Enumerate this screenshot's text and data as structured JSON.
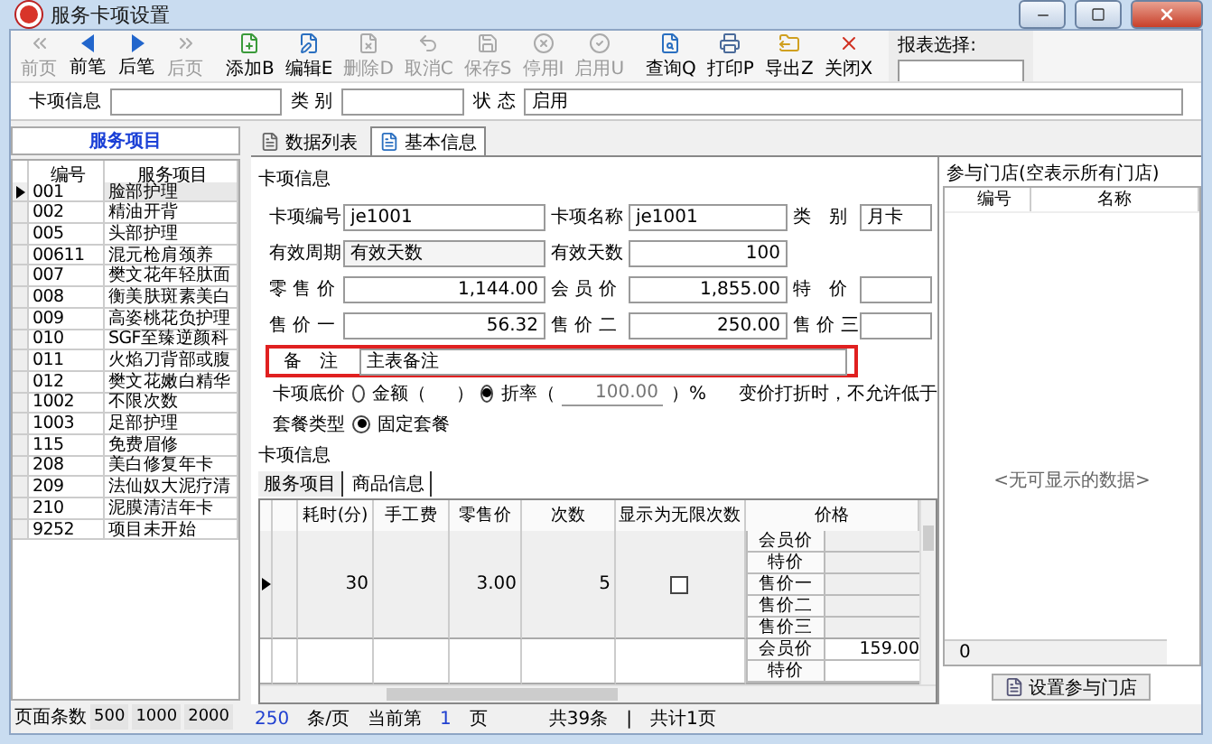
{
  "window": {
    "title": "服务卡项设置"
  },
  "toolbar": [
    {
      "kind": "first",
      "label": "前页",
      "disabled": true
    },
    {
      "kind": "prev",
      "label": "前笔",
      "disabled": false
    },
    {
      "kind": "next",
      "label": "后笔",
      "disabled": false
    },
    {
      "kind": "last",
      "label": "后页",
      "disabled": true
    },
    {
      "kind": "add",
      "label": "添加B",
      "disabled": false
    },
    {
      "kind": "edit",
      "label": "编辑E",
      "disabled": false
    },
    {
      "kind": "delete",
      "label": "删除D",
      "disabled": true
    },
    {
      "kind": "cancel",
      "label": "取消C",
      "disabled": true
    },
    {
      "kind": "save",
      "label": "保存S",
      "disabled": true
    },
    {
      "kind": "stop",
      "label": "停用I",
      "disabled": true
    },
    {
      "kind": "enable",
      "label": "启用U",
      "disabled": true
    },
    {
      "kind": "query",
      "label": "查询Q",
      "disabled": false
    },
    {
      "kind": "print",
      "label": "打印P",
      "disabled": false
    },
    {
      "kind": "export",
      "label": "导出Z",
      "disabled": false
    },
    {
      "kind": "close",
      "label": "关闭X",
      "disabled": false
    }
  ],
  "report_select": {
    "label": "报表选择:"
  },
  "filter": [
    {
      "label": "卡项信息"
    },
    {
      "label": "类 别"
    },
    {
      "label": "状 态",
      "value": "启用"
    }
  ],
  "left_panel": {
    "title": "服务项目",
    "columns": [
      "编号",
      "服务项目"
    ],
    "rows": [
      {
        "code": "001",
        "name": "脸部护理",
        "selected": true
      },
      {
        "code": "002",
        "name": "精油开背",
        "selected": false
      },
      {
        "code": "005",
        "name": "头部护理",
        "selected": false
      },
      {
        "code": "00611",
        "name": "混元枪肩颈养",
        "selected": false
      },
      {
        "code": "007",
        "name": "樊文花年轻肽面",
        "selected": false
      },
      {
        "code": "008",
        "name": "衡美肤斑素美白",
        "selected": false
      },
      {
        "code": "009",
        "name": "高姿桃花负护理",
        "selected": false
      },
      {
        "code": "010",
        "name": "SGF至臻逆颜科",
        "selected": false
      },
      {
        "code": "011",
        "name": "火焰刀背部或腹",
        "selected": false
      },
      {
        "code": "012",
        "name": "樊文花嫩白精华",
        "selected": false
      },
      {
        "code": "1002",
        "name": "不限次数",
        "selected": false
      },
      {
        "code": "1003",
        "name": "足部护理",
        "selected": false
      },
      {
        "code": "115",
        "name": "免费眉修",
        "selected": false
      },
      {
        "code": "208",
        "name": "美白修复年卡",
        "selected": false
      },
      {
        "code": "209",
        "name": "法仙奴大泥疗清",
        "selected": false
      },
      {
        "code": "210",
        "name": "泥膜清洁年卡",
        "selected": false
      },
      {
        "code": "9252",
        "name": "项目未开始",
        "selected": false
      }
    ],
    "page_sizes_label": "页面条数",
    "page_sizes": [
      "500",
      "1000",
      "2000"
    ]
  },
  "tabs": [
    {
      "label": "数据列表",
      "selected": false
    },
    {
      "label": "基本信息",
      "selected": true
    }
  ],
  "form": {
    "section": "卡项信息",
    "rows": [
      [
        {
          "label": "卡项编号",
          "value": "je1001"
        },
        {
          "label": "卡项名称",
          "value": "je1001"
        },
        {
          "label": "类　别",
          "value": "月卡"
        }
      ],
      [
        {
          "label": "有效周期",
          "value": "有效天数"
        },
        {
          "label": "有效天数",
          "value": "100"
        }
      ],
      [
        {
          "label": "零 售 价",
          "value": "1,144.00"
        },
        {
          "label": "会 员 价",
          "value": "1,855.00"
        },
        {
          "label": "特　价"
        }
      ],
      [
        {
          "label": "售 价 一",
          "value": "56.32"
        },
        {
          "label": "售 价 二",
          "value": "250.00"
        },
        {
          "label": "售 价 三"
        }
      ]
    ],
    "remark": {
      "label": "备　注",
      "value": "主表备注"
    },
    "floor": {
      "label": "卡项底价",
      "options": [
        {
          "label": "金额（",
          "close": "）",
          "selected": false
        },
        {
          "label": "折率（",
          "close": "）%",
          "placeholder": "100.00",
          "selected": true
        }
      ],
      "note": "变价打折时，不允许低于"
    },
    "package": {
      "label": "套餐类型",
      "options": [
        {
          "label": "固定套餐",
          "selected": true
        }
      ]
    },
    "section2": "卡项信息",
    "subtabs": [
      "服务项目",
      "商品信息"
    ]
  },
  "grid": {
    "columns": [
      "耗时(分)",
      "手工费",
      "零售价",
      "次数",
      "显示为无限次数",
      "价格"
    ],
    "rows": [
      {
        "selected": true,
        "time": "30",
        "retail": "3.00",
        "count": "5",
        "unlimited": false,
        "prices": [
          {
            "name": "会员价"
          },
          {
            "name": "特价"
          },
          {
            "name": "售价一"
          },
          {
            "name": "售价二"
          },
          {
            "name": "售价三"
          }
        ]
      },
      {
        "selected": false,
        "prices": [
          {
            "name": "会员价",
            "value": "159.00"
          },
          {
            "name": "特价"
          }
        ]
      }
    ]
  },
  "stores": {
    "title": "参与门店(空表示所有门店)",
    "columns": [
      "编号",
      "名称"
    ],
    "empty": "<无可显示的数据>",
    "count": "0",
    "button": "设置参与门店"
  },
  "status": {
    "per_page": "250",
    "per_page_unit": "条/页",
    "current_label": "当前第",
    "current": "1",
    "current_unit": "页",
    "total": "共39条",
    "sep": "|",
    "pages": "共计1页"
  }
}
